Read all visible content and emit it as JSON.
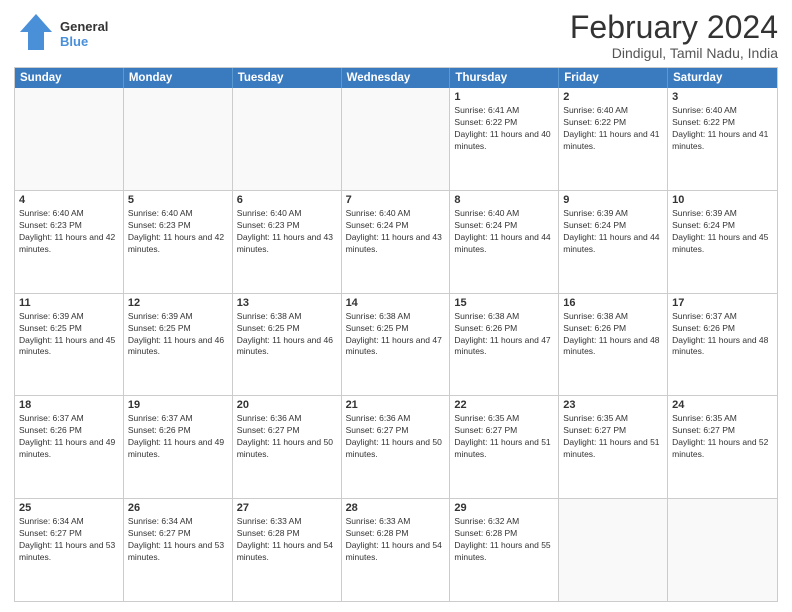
{
  "logo": {
    "line1": "General",
    "line2": "Blue"
  },
  "title": "February 2024",
  "subtitle": "Dindigul, Tamil Nadu, India",
  "header_days": [
    "Sunday",
    "Monday",
    "Tuesday",
    "Wednesday",
    "Thursday",
    "Friday",
    "Saturday"
  ],
  "weeks": [
    [
      {
        "day": "",
        "info": ""
      },
      {
        "day": "",
        "info": ""
      },
      {
        "day": "",
        "info": ""
      },
      {
        "day": "",
        "info": ""
      },
      {
        "day": "1",
        "info": "Sunrise: 6:41 AM\nSunset: 6:22 PM\nDaylight: 11 hours and 40 minutes."
      },
      {
        "day": "2",
        "info": "Sunrise: 6:40 AM\nSunset: 6:22 PM\nDaylight: 11 hours and 41 minutes."
      },
      {
        "day": "3",
        "info": "Sunrise: 6:40 AM\nSunset: 6:22 PM\nDaylight: 11 hours and 41 minutes."
      }
    ],
    [
      {
        "day": "4",
        "info": "Sunrise: 6:40 AM\nSunset: 6:23 PM\nDaylight: 11 hours and 42 minutes."
      },
      {
        "day": "5",
        "info": "Sunrise: 6:40 AM\nSunset: 6:23 PM\nDaylight: 11 hours and 42 minutes."
      },
      {
        "day": "6",
        "info": "Sunrise: 6:40 AM\nSunset: 6:23 PM\nDaylight: 11 hours and 43 minutes."
      },
      {
        "day": "7",
        "info": "Sunrise: 6:40 AM\nSunset: 6:24 PM\nDaylight: 11 hours and 43 minutes."
      },
      {
        "day": "8",
        "info": "Sunrise: 6:40 AM\nSunset: 6:24 PM\nDaylight: 11 hours and 44 minutes."
      },
      {
        "day": "9",
        "info": "Sunrise: 6:39 AM\nSunset: 6:24 PM\nDaylight: 11 hours and 44 minutes."
      },
      {
        "day": "10",
        "info": "Sunrise: 6:39 AM\nSunset: 6:24 PM\nDaylight: 11 hours and 45 minutes."
      }
    ],
    [
      {
        "day": "11",
        "info": "Sunrise: 6:39 AM\nSunset: 6:25 PM\nDaylight: 11 hours and 45 minutes."
      },
      {
        "day": "12",
        "info": "Sunrise: 6:39 AM\nSunset: 6:25 PM\nDaylight: 11 hours and 46 minutes."
      },
      {
        "day": "13",
        "info": "Sunrise: 6:38 AM\nSunset: 6:25 PM\nDaylight: 11 hours and 46 minutes."
      },
      {
        "day": "14",
        "info": "Sunrise: 6:38 AM\nSunset: 6:25 PM\nDaylight: 11 hours and 47 minutes."
      },
      {
        "day": "15",
        "info": "Sunrise: 6:38 AM\nSunset: 6:26 PM\nDaylight: 11 hours and 47 minutes."
      },
      {
        "day": "16",
        "info": "Sunrise: 6:38 AM\nSunset: 6:26 PM\nDaylight: 11 hours and 48 minutes."
      },
      {
        "day": "17",
        "info": "Sunrise: 6:37 AM\nSunset: 6:26 PM\nDaylight: 11 hours and 48 minutes."
      }
    ],
    [
      {
        "day": "18",
        "info": "Sunrise: 6:37 AM\nSunset: 6:26 PM\nDaylight: 11 hours and 49 minutes."
      },
      {
        "day": "19",
        "info": "Sunrise: 6:37 AM\nSunset: 6:26 PM\nDaylight: 11 hours and 49 minutes."
      },
      {
        "day": "20",
        "info": "Sunrise: 6:36 AM\nSunset: 6:27 PM\nDaylight: 11 hours and 50 minutes."
      },
      {
        "day": "21",
        "info": "Sunrise: 6:36 AM\nSunset: 6:27 PM\nDaylight: 11 hours and 50 minutes."
      },
      {
        "day": "22",
        "info": "Sunrise: 6:35 AM\nSunset: 6:27 PM\nDaylight: 11 hours and 51 minutes."
      },
      {
        "day": "23",
        "info": "Sunrise: 6:35 AM\nSunset: 6:27 PM\nDaylight: 11 hours and 51 minutes."
      },
      {
        "day": "24",
        "info": "Sunrise: 6:35 AM\nSunset: 6:27 PM\nDaylight: 11 hours and 52 minutes."
      }
    ],
    [
      {
        "day": "25",
        "info": "Sunrise: 6:34 AM\nSunset: 6:27 PM\nDaylight: 11 hours and 53 minutes."
      },
      {
        "day": "26",
        "info": "Sunrise: 6:34 AM\nSunset: 6:27 PM\nDaylight: 11 hours and 53 minutes."
      },
      {
        "day": "27",
        "info": "Sunrise: 6:33 AM\nSunset: 6:28 PM\nDaylight: 11 hours and 54 minutes."
      },
      {
        "day": "28",
        "info": "Sunrise: 6:33 AM\nSunset: 6:28 PM\nDaylight: 11 hours and 54 minutes."
      },
      {
        "day": "29",
        "info": "Sunrise: 6:32 AM\nSunset: 6:28 PM\nDaylight: 11 hours and 55 minutes."
      },
      {
        "day": "",
        "info": ""
      },
      {
        "day": "",
        "info": ""
      }
    ]
  ]
}
